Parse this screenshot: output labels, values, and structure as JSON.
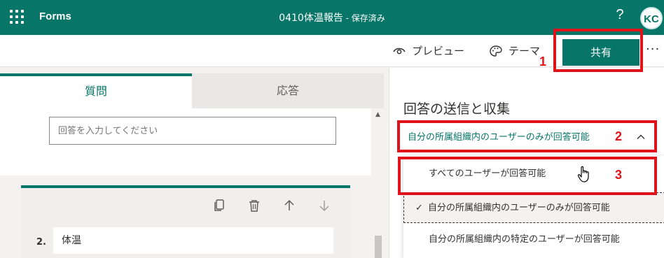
{
  "topbar": {
    "app_name": "Forms",
    "doc_title": "0410体温報告",
    "doc_separator": " - ",
    "doc_status": "保存済み",
    "help_label": "?",
    "avatar_initials": "KC"
  },
  "commandbar": {
    "preview_label": "プレビュー",
    "theme_label": "テーマ",
    "share_label": "共有",
    "more_label": "···"
  },
  "annotations": {
    "label_1": "1",
    "label_2": "2",
    "label_3": "3",
    "highlight_color": "#e0131a"
  },
  "editor": {
    "tabs": [
      {
        "label": "質問",
        "active": true
      },
      {
        "label": "応答",
        "active": false
      }
    ],
    "answer_placeholder": "回答を入力してください",
    "scroll_up_label": "▲",
    "question": {
      "number": "2.",
      "title": "体温",
      "toolbar_icons": [
        "copy-icon",
        "trash-icon",
        "arrow-up-icon",
        "arrow-down-icon"
      ]
    }
  },
  "share_panel": {
    "title": "回答の送信と収集",
    "current_permission": "自分の所属組織内のユーザーのみが回答可能",
    "options": [
      {
        "label": "すべてのユーザーが回答可能",
        "selected": false
      },
      {
        "label": "自分の所属組織内のユーザーのみが回答可能",
        "selected": true
      },
      {
        "label": "自分の所属組織内の特定のユーザーが回答可能",
        "selected": false
      }
    ],
    "check_mark": "✓"
  },
  "colors": {
    "brand": "#077568",
    "highlight": "#e0131a",
    "background": "#f3f2f1"
  }
}
